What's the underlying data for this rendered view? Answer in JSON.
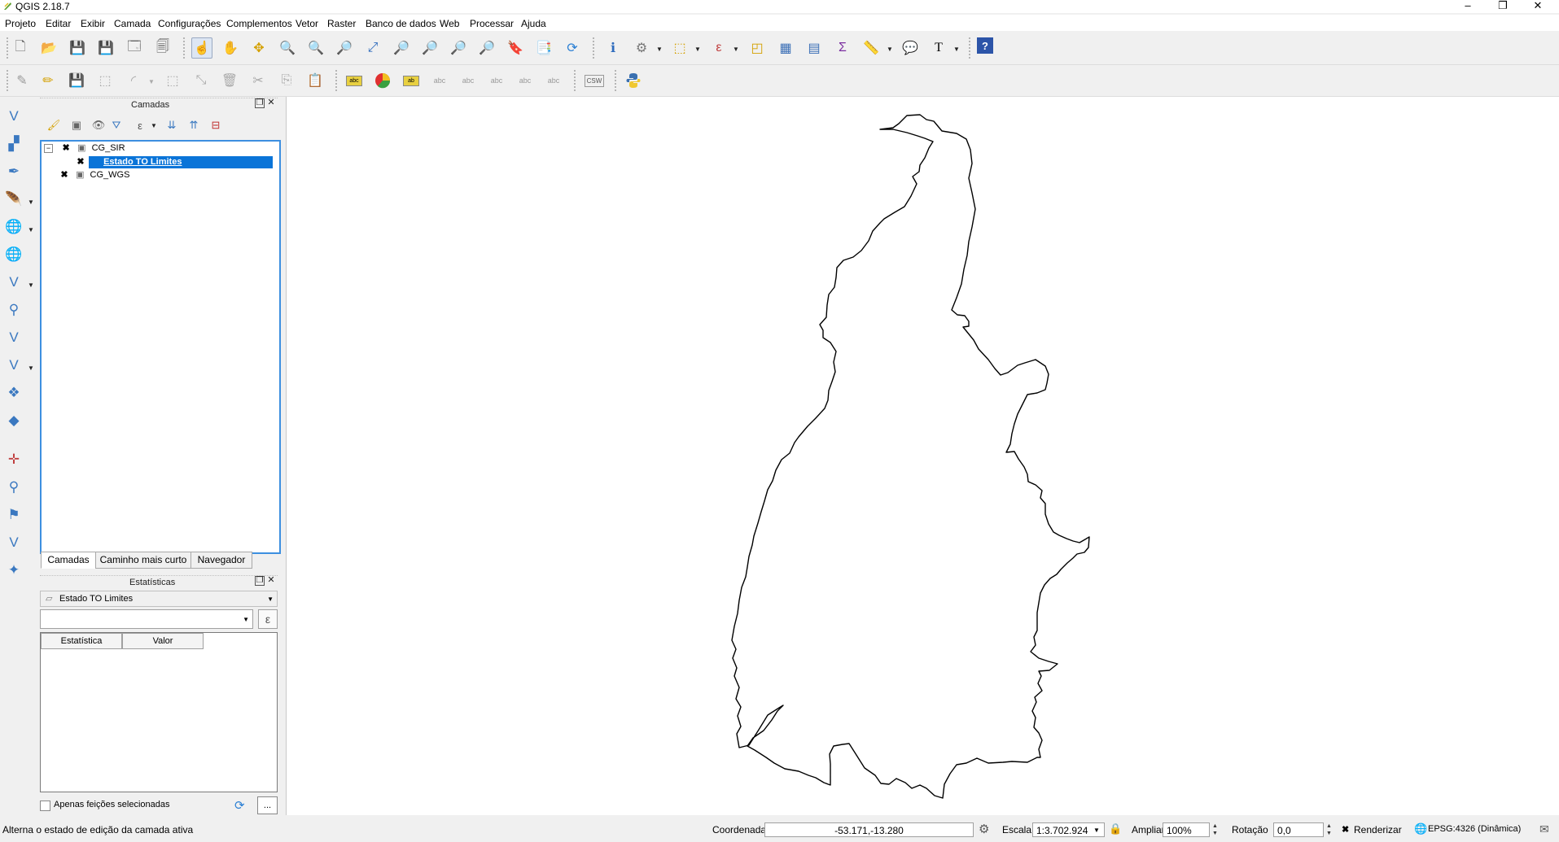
{
  "window": {
    "title": "QGIS 2.18.7",
    "controls": {
      "minimize": "–",
      "restore": "❐",
      "close": "✕"
    }
  },
  "menu": [
    "Projeto",
    "Editar",
    "Exibir",
    "Camada",
    "Configurações",
    "Complementos",
    "Vetor",
    "Raster",
    "Banco de dados",
    "Web",
    "Processar",
    "Ajuda"
  ],
  "toolbar": {
    "csw_label": "CSW",
    "text_annotation_label": "T",
    "help_label": "?"
  },
  "layers_panel": {
    "title": "Camadas",
    "tree": [
      {
        "name": "CG_SIR",
        "type": "group",
        "checked": true,
        "expanded": true
      },
      {
        "name": "Estado TO Limites",
        "type": "layer",
        "checked": true,
        "selected": true
      },
      {
        "name": "CG_WGS",
        "type": "group",
        "checked": true,
        "expanded": false
      }
    ],
    "tabs": [
      "Camadas",
      "Caminho mais curto",
      "Navegador"
    ],
    "active_tab": "Camadas"
  },
  "stats_panel": {
    "title": "Estatísticas",
    "layer_select": "Estado TO Limites",
    "field_select": "",
    "expression_button": "ε",
    "columns": [
      "Estatística",
      "Valor"
    ],
    "only_selected_label": "Apenas feições selecionadas",
    "more_button": "..."
  },
  "statusbar": {
    "message": "Alterna o estado de edição da camada ativa",
    "coordinate_label": "Coordenada",
    "coordinate_value": "-53.171,-13.280",
    "scale_label": "Escala",
    "scale_value": "1:3.702.924",
    "magnify_label": "Ampliar",
    "magnify_value": "100%",
    "rotation_label": "Rotação",
    "rotation_value": "0,0",
    "render_label": "Renderizar",
    "render_checked": true,
    "crs_label": "EPSG:4326 (Dinâmica)"
  },
  "colors": {
    "selection": "#0a74d8",
    "panel_focus_border": "#3d8fe0",
    "map_background": "#ffffff",
    "feature_outline": "#000000"
  }
}
